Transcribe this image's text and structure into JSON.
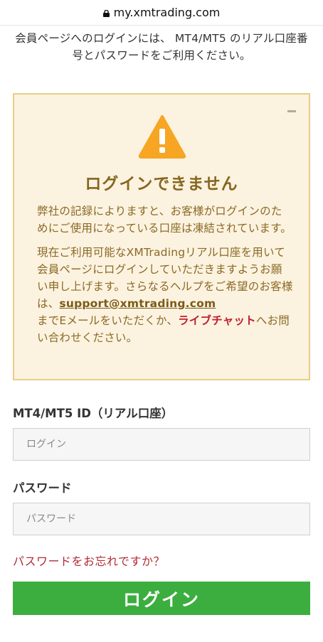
{
  "browser": {
    "url": "my.xmtrading.com"
  },
  "intro": {
    "text": "会員ページへのログインには、 MT4/MT5 のリアル口座番号とパスワードをご利用ください。"
  },
  "alert": {
    "title": "ログインできません",
    "paragraph1": "弊社の記録によりますと、お客様がログインのためにご使用になっている口座は凍結されています。",
    "paragraph2_part1": "現在ご利用可能なXMTradingリアル口座を用いて会員ページにログインしていただきますようお願い申し上げます。さらなるヘルプをご希望のお客様は、",
    "support_email": "support@xmtrading.com",
    "paragraph2_part2": "までEメールをいただくか、",
    "live_chat": "ライブチャット",
    "paragraph2_part3": "へお問い合わせください。",
    "icon": "warning-triangle-icon",
    "colors": {
      "background": "#fcf2e0",
      "border": "#e7ce85",
      "text": "#8a6a24",
      "icon": "#f6a623"
    }
  },
  "form": {
    "id_label": "MT4/MT5 ID（リアル口座）",
    "id_placeholder": "ログイン",
    "password_label": "パスワード",
    "password_placeholder": "パスワード",
    "forgot_link": "パスワードをお忘れですか？",
    "login_button": "ログイン",
    "colors": {
      "button": "#3cae3f",
      "link": "#b22b34"
    }
  }
}
